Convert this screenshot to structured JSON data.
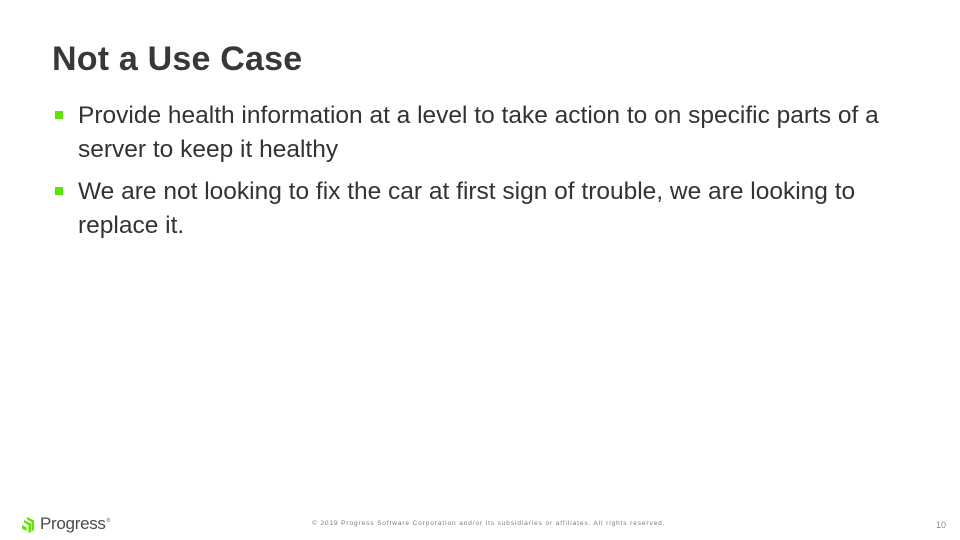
{
  "slide": {
    "title": "Not a Use Case",
    "bullets": [
      {
        "text": "Provide health information at a level to take action to on specific parts of a server to keep it healthy"
      },
      {
        "text": "We are not looking to fix the car at first sign of trouble, we are looking to replace it."
      }
    ]
  },
  "footer": {
    "logo_text": "Progress",
    "logo_registered": "®",
    "logo_icon": "progress-logo-icon",
    "copyright": "© 2019 Progress Software Corporation and/or its subsidiaries or affiliates. All rights reserved.",
    "page_number": "10"
  },
  "colors": {
    "bullet_accent": "#5ce500",
    "logo_green": "#5ce500",
    "text": "#333337"
  }
}
